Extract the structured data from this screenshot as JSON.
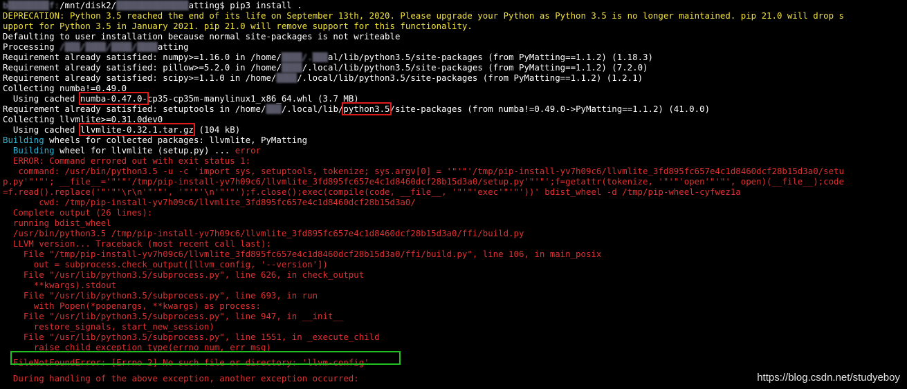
{
  "prompt": {
    "user_host": "b▒▒▒▒▒▒▒▒f:",
    "path_a": "/mnt/disk2/",
    "path_blur": "▒▒▒▒▒▒▒▒▒▒▒▒▒▒",
    "path_b": "atting$ ",
    "command": "pip3 install ."
  },
  "lines": {
    "l1": "DEPRECATION: Python 3.5 reached the end of its life on September 13th, 2020. Please upgrade your Python as Python 3.5 is no longer maintained. pip 21.0 will drop s",
    "l2": "upport for Python 3.5 in January 2021. pip 21.0 will remove support for this functionality.",
    "l3": "Defaulting to user installation because normal site-packages is not writeable",
    "l4a": "Processing ",
    "l4b": "/▒▒▒/▒▒▒▒/▒▒▒▒/▒▒▒▒",
    "l4c": "atting",
    "l5a": "Requirement already satisfied: numpy>=1.16.0 in /home/",
    "l5b": "▒▒▒▒/.▒▒▒",
    "l5c": "al/lib/python3.5/site-packages (from PyMatting==1.1.2) (1.18.3)",
    "l6a": "Requirement already satisfied: pillow>=5.2.0 in /home/",
    "l6b": "▒▒▒▒",
    "l6c": "/.local/lib/python3.5/site-packages (from PyMatting==1.1.2) (7.2.0)",
    "l7a": "Requirement already satisfied: scipy>=1.1.0 in /home/",
    "l7b": "▒▒▒▒",
    "l7c": "/.local/lib/python3.5/site-packages (from PyMatting==1.1.2) (1.2.1)",
    "l8": "Collecting numba!=0.49.0",
    "l9a": "  Using cached ",
    "l9b": "numba-0.47.0-",
    "l9c": "cp35-cp35m-manylinux1_x86_64.whl (3.7 MB)",
    "l10a": "Requirement already satisfied: setuptools in /home/",
    "l10b": "▒▒▒",
    "l10c": "/.local/lib/",
    "l10d": "python3.5",
    "l10e": "/site-packages (from numba!=0.49.0->PyMatting==1.1.2) (41.0.0)",
    "l11": "Collecting llvmlite>=0.31.0dev0",
    "l12a": "  Using cached ",
    "l12b": "llvmlite-0.32.1.tar.gz",
    "l12c": " (104 kB)",
    "l13a": "Building",
    "l13b": " wheels for collected packages: llvmlite, PyMatting",
    "l14a": "  Building",
    "l14b": " wheel for llvmlite (setup.py) ... ",
    "l14c": "error",
    "l15": "  ERROR: Command errored out with exit status 1:",
    "l16": "   command: /usr/bin/python3.5 -u -c 'import sys, setuptools, tokenize; sys.argv[0] = '\"'\"'/tmp/pip-install-yv7h09c6/llvmlite_3fd895fc657e4c1d8460dcf28b15d3a0/setu",
    "l17": "p.py'\"'\"'; __file__='\"'\"'/tmp/pip-install-yv7h09c6/llvmlite_3fd895fc657e4c1d8460dcf28b15d3a0/setup.py'\"'\"';f=getattr(tokenize, '\"'\"'open'\"'\"', open)(__file__);code",
    "l18": "=f.read().replace('\"'\"'\\r\\n'\"'\"', '\"'\"'\\n'\"'\"');f.close();exec(compile(code, __file__, '\"'\"'exec'\"'\"'))' bdist_wheel -d /tmp/pip-wheel-cyfwez1a",
    "l19": "       cwd: /tmp/pip-install-yv7h09c6/llvmlite_3fd895fc657e4c1d8460dcf28b15d3a0/",
    "l20": "  Complete output (26 lines):",
    "l21": "  running bdist_wheel",
    "l22": "  /usr/bin/python3.5 /tmp/pip-install-yv7h09c6/llvmlite_3fd895fc657e4c1d8460dcf28b15d3a0/ffi/build.py",
    "l23": "  LLVM version... Traceback (most recent call last):",
    "l24": "    File \"/tmp/pip-install-yv7h09c6/llvmlite_3fd895fc657e4c1d8460dcf28b15d3a0/ffi/build.py\", line 106, in main_posix",
    "l25": "      out = subprocess.check_output([llvm_config, '--version'])",
    "l26": "    File \"/usr/lib/python3.5/subprocess.py\", line 626, in check_output",
    "l27": "      **kwargs).stdout",
    "l28": "    File \"/usr/lib/python3.5/subprocess.py\", line 693, in run",
    "l29": "      with Popen(*popenargs, **kwargs) as process:",
    "l30": "    File \"/usr/lib/python3.5/subprocess.py\", line 947, in __init__",
    "l31": "      restore_signals, start_new_session)",
    "l32": "    File \"/usr/lib/python3.5/subprocess.py\", line 1551, in _execute_child",
    "l33": "      raise child_exception_type(errno_num, err_msg)",
    "l34": "  FileNotFoundError: [Errno 2] No such file or directory: 'llvm-config'",
    "l35": "",
    "l36": "  During handling of the above exception, another exception occurred:"
  },
  "watermark": "https://blog.csdn.net/studyeboy",
  "colors": {
    "background": "#000000",
    "text": "#ffffff",
    "warning": "#f0e040",
    "error": "#e03131",
    "building": "#2fb6d6",
    "highlight_red": "#e01919",
    "highlight_green": "#20c020"
  }
}
